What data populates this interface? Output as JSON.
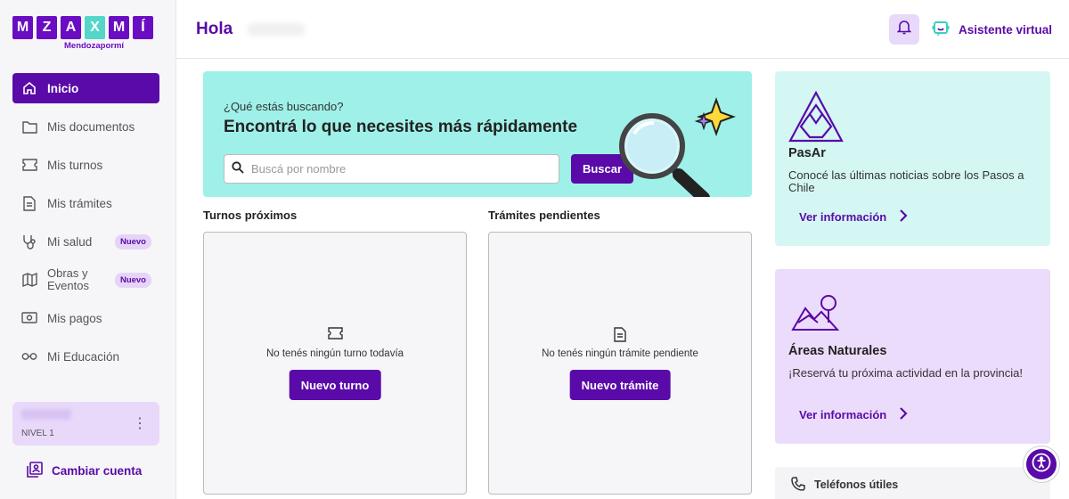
{
  "brand": {
    "letters": [
      "M",
      "Z",
      "A",
      "X",
      "M",
      "Í"
    ],
    "subtitle": "Mendozapormí"
  },
  "sidebar": {
    "items": [
      {
        "label": "Inicio",
        "icon": "home-icon",
        "active": true
      },
      {
        "label": "Mis documentos",
        "icon": "folder-icon"
      },
      {
        "label": "Mis turnos",
        "icon": "ticket-icon"
      },
      {
        "label": "Mis trámites",
        "icon": "document-icon"
      },
      {
        "label": "Mi salud",
        "icon": "stethoscope-icon",
        "badge": "Nuevo"
      },
      {
        "label": "Obras y Eventos",
        "icon": "map-icon",
        "badge": "Nuevo"
      },
      {
        "label": "Mis pagos",
        "icon": "cash-icon"
      },
      {
        "label": "Mi Educación",
        "icon": "glasses-icon"
      }
    ],
    "level": "NIVEL 1",
    "switch_account": "Cambiar cuenta"
  },
  "header": {
    "greeting": "Hola",
    "assistant": "Asistente virtual"
  },
  "hero": {
    "question": "¿Qué estás buscando?",
    "headline": "Encontrá lo que necesites más rápidamente",
    "search_placeholder": "Buscá por nombre",
    "search_button": "Buscar"
  },
  "turnos": {
    "title": "Turnos próximos",
    "empty": "No tenés ningún turno todavía",
    "button": "Nuevo turno"
  },
  "tramites": {
    "title": "Trámites pendientes",
    "empty": "No tenés ningún trámite pendiente",
    "button": "Nuevo trámite"
  },
  "cards": {
    "pasar": {
      "title": "PasAr",
      "desc": "Conocé las últimas noticias sobre los Pasos a Chile",
      "link": "Ver información"
    },
    "areas": {
      "title": "Áreas Naturales",
      "desc": "¡Reservá tu próxima actividad en la provincia!",
      "link": "Ver información"
    },
    "telefonos": {
      "title": "Teléfonos útiles"
    }
  },
  "colors": {
    "primary": "#5a0aa8",
    "teal": "#9ff0e8",
    "lavender": "#e8d9fa",
    "mint": "#d4f7f4"
  }
}
